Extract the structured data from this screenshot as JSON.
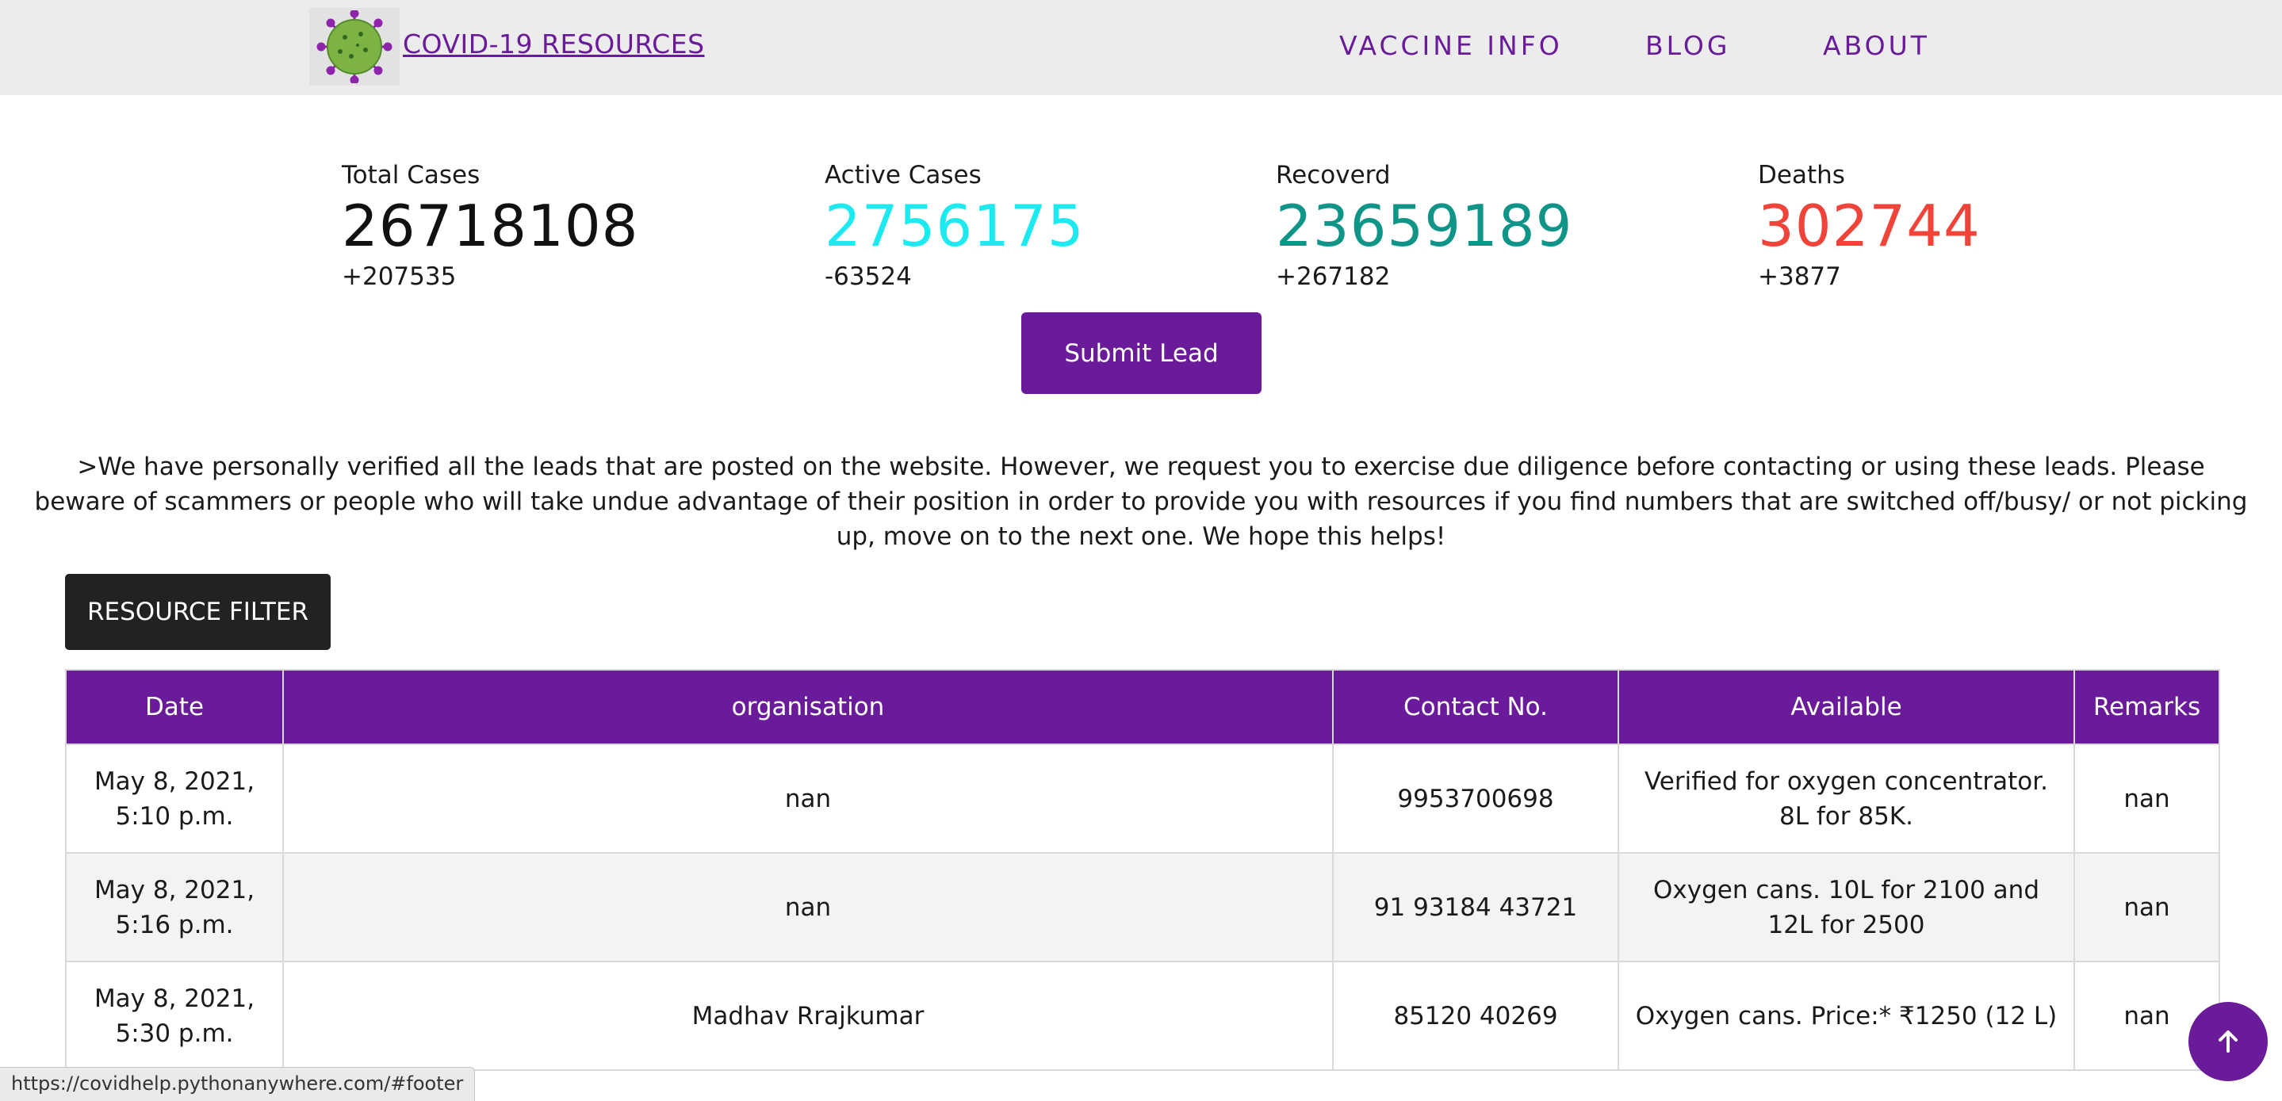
{
  "header": {
    "brand": "COVID-19 RESOURCES",
    "nav": [
      {
        "label": "VACCINE INFO"
      },
      {
        "label": "BLOG"
      },
      {
        "label": "ABOUT"
      }
    ],
    "logo_icon": "virus-icon"
  },
  "stats": {
    "total": {
      "label": "Total Cases",
      "value": "26718108",
      "delta": "+207535",
      "color": "#111111"
    },
    "active": {
      "label": "Active Cases",
      "value": "2756175",
      "delta": "-63524",
      "color": "#1de9f0"
    },
    "recovered": {
      "label": "Recoverd",
      "value": "23659189",
      "delta": "+267182",
      "color": "#0f9488"
    },
    "deaths": {
      "label": "Deaths",
      "value": "302744",
      "delta": "+3877",
      "color": "#f0443a"
    }
  },
  "submit_label": "Submit Lead",
  "notice": ">We have personally verified all the leads that are posted on the website. However, we request you to exercise due diligence before contacting or using these leads. Please beware of scammers or people who will take undue advantage of their position in order to provide you with resources if you find numbers that are switched off/busy/ or not picking up, move on to the next one. We hope this helps!",
  "filter_label": "RESOURCE FILTER",
  "table": {
    "headers": [
      "Date",
      "organisation",
      "Contact No.",
      "Available",
      "Remarks"
    ],
    "rows": [
      [
        "May 8, 2021, 5:10 p.m.",
        "nan",
        "9953700698",
        "Verified for oxygen concentrator. 8L for 85K.",
        "nan"
      ],
      [
        "May 8, 2021, 5:16 p.m.",
        "nan",
        "91 93184 43721",
        "Oxygen cans. 10L for 2100 and 12L for 2500",
        "nan"
      ],
      [
        "May 8, 2021, 5:30 p.m.",
        "Madhav Rrajkumar",
        "85120 40269",
        "Oxygen cans. Price:* ₹1250 (12 L)",
        "nan"
      ]
    ]
  },
  "status_url": "https://covidhelp.pythonanywhere.com/#footer",
  "scroll_top_icon": "arrow-up-icon",
  "colors": {
    "accent": "#6a1b9a",
    "header_bg": "#ececec",
    "dark_button": "#222222"
  }
}
